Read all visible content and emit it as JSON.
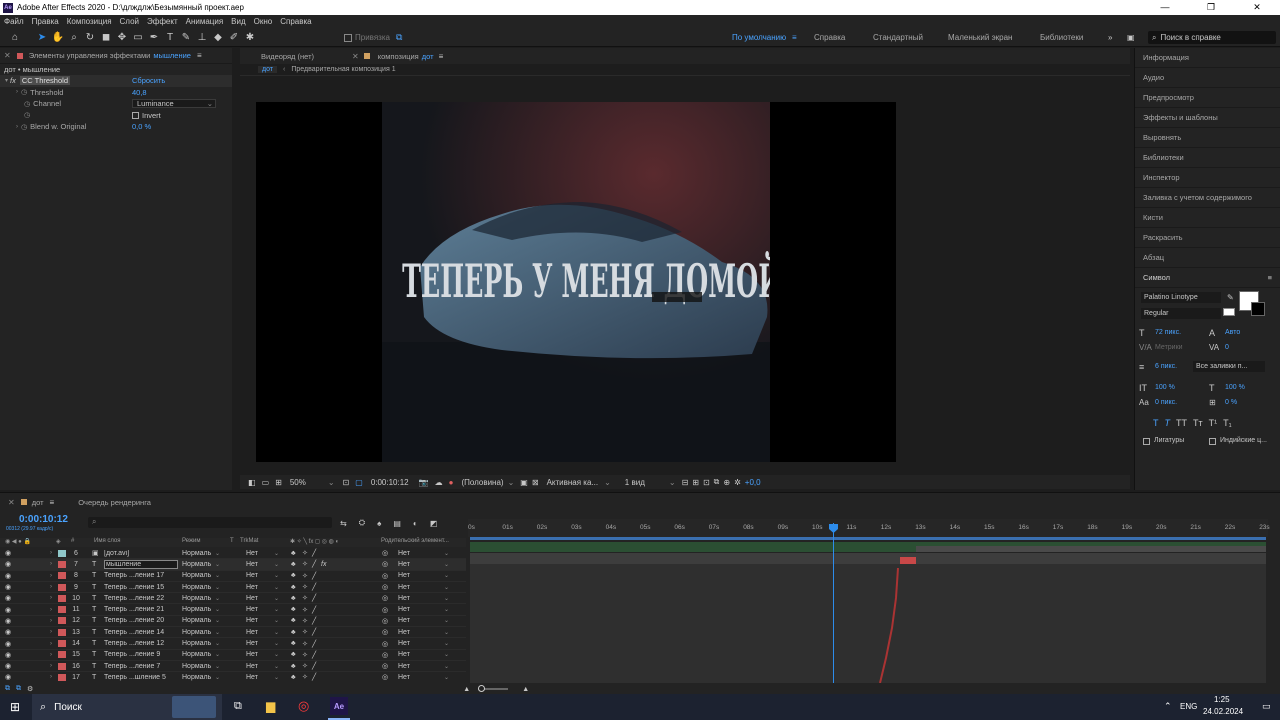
{
  "window": {
    "title": "Adobe After Effects 2020 - D:\\длждлж\\Безымянный проект.aep",
    "logo": "Ae"
  },
  "menu": [
    "Файл",
    "Правка",
    "Композиция",
    "Слой",
    "Эффект",
    "Анимация",
    "Вид",
    "Окно",
    "Справка"
  ],
  "toolbar": {
    "snap_label": "Привязка",
    "workspaces": [
      "По умолчанию",
      "Справка",
      "Стандартный",
      "Маленький экран",
      "Библиотеки"
    ],
    "help_search_placeholder": "Поиск в справке"
  },
  "effects_panel": {
    "tab_label": "Элементы управления эффектами",
    "tab_layer": "мышление",
    "breadcrumb": "дот • мышление",
    "effect_name": "CC Threshold",
    "reset_label": "Сбросить",
    "params": [
      {
        "label": "Threshold",
        "value": "40,8"
      },
      {
        "label": "Channel",
        "value": "Luminance"
      },
      {
        "label": "",
        "value": "Invert"
      },
      {
        "label": "Blend w. Original",
        "value": "0,0 %"
      }
    ]
  },
  "comp_panel": {
    "tab_footage": "Видеоряд (нет)",
    "tab_comp": "композиция",
    "tab_comp_name": "дот",
    "breadcrumb_active": "дот",
    "breadcrumb_next": "Предварительная композиция 1",
    "image_text": "ТЕПЕРЬ У МЕНЯ ДОМОЙ",
    "footer": {
      "zoom": "50%",
      "timecode": "0:00:10:12",
      "resolution": "(Половина)",
      "camera": "Активная ка...",
      "views": "1 вид",
      "exposure": "+0,0"
    }
  },
  "right_panel": {
    "items": [
      "Информация",
      "Аудио",
      "Предпросмотр",
      "Эффекты и шаблоны",
      "Выровнять",
      "Библиотеки",
      "Инспектор",
      "Заливка с учетом содержимого",
      "Кисти",
      "Раскрасить",
      "Абзац",
      "Символ"
    ],
    "character": {
      "font": "Palatino Linotype",
      "style": "Regular",
      "size": "72 пикс.",
      "leading": "Авто",
      "kerning": "Метрики",
      "tracking": "0",
      "stroke": "6 пикс.",
      "stroke_mode": "Все заливки п...",
      "vscale": "100 %",
      "hscale": "100 %",
      "baseline": "0 пикс.",
      "tsume": "0 %",
      "ligatures": "Лигатуры",
      "hindi": "Индийские ц..."
    }
  },
  "timeline": {
    "tab_comp": "дот",
    "tab_render": "Очередь рендеринга",
    "timecode": "0:00:10:12",
    "fps": "00312 (29.97 кадр/с)",
    "columns": {
      "name": "Имя слоя",
      "mode": "Режим",
      "t": "T",
      "trkmat": "TrkMat",
      "parent": "Родительский элемент..."
    },
    "ruler": [
      "0s",
      "01s",
      "02s",
      "03s",
      "04s",
      "05s",
      "06s",
      "07s",
      "08s",
      "09s",
      "10s",
      "11s",
      "12s",
      "13s",
      "14s",
      "15s",
      "16s",
      "17s",
      "18s",
      "19s",
      "20s",
      "21s",
      "22s",
      "23s"
    ],
    "layers": [
      {
        "num": "6",
        "name": "[дот.avi]",
        "mode": "Нормаль",
        "trk": "Нет",
        "parent": "Нет",
        "color": "#8fc7c9",
        "type": "▣"
      },
      {
        "num": "7",
        "name": "мышление",
        "mode": "Нормаль",
        "trk": "Нет",
        "parent": "Нет",
        "color": "#d0585a",
        "type": "T"
      },
      {
        "num": "8",
        "name": "Теперь ...ление 17",
        "mode": "Нормаль",
        "trk": "Нет",
        "parent": "Нет",
        "color": "#d0585a",
        "type": "T"
      },
      {
        "num": "9",
        "name": "Теперь ...ление 15",
        "mode": "Нормаль",
        "trk": "Нет",
        "parent": "Нет",
        "color": "#d0585a",
        "type": "T"
      },
      {
        "num": "10",
        "name": "Теперь ...ление 22",
        "mode": "Нормаль",
        "trk": "Нет",
        "parent": "Нет",
        "color": "#d0585a",
        "type": "T"
      },
      {
        "num": "11",
        "name": "Теперь ...ление 21",
        "mode": "Нормаль",
        "trk": "Нет",
        "parent": "Нет",
        "color": "#d0585a",
        "type": "T"
      },
      {
        "num": "12",
        "name": "Теперь ...ление 20",
        "mode": "Нормаль",
        "trk": "Нет",
        "parent": "Нет",
        "color": "#d0585a",
        "type": "T"
      },
      {
        "num": "13",
        "name": "Теперь ...ление 14",
        "mode": "Нормаль",
        "trk": "Нет",
        "parent": "Нет",
        "color": "#d0585a",
        "type": "T"
      },
      {
        "num": "14",
        "name": "Теперь ...ление 12",
        "mode": "Нормаль",
        "trk": "Нет",
        "parent": "Нет",
        "color": "#d0585a",
        "type": "T"
      },
      {
        "num": "15",
        "name": "Теперь ...ление 9",
        "mode": "Нормаль",
        "trk": "Нет",
        "parent": "Нет",
        "color": "#d0585a",
        "type": "T"
      },
      {
        "num": "16",
        "name": "Теперь ...ление 7",
        "mode": "Нормаль",
        "trk": "Нет",
        "parent": "Нет",
        "color": "#d0585a",
        "type": "T"
      },
      {
        "num": "17",
        "name": "Теперь ...шление 5",
        "mode": "Нормаль",
        "trk": "Нет",
        "parent": "Нет",
        "color": "#d0585a",
        "type": "T"
      }
    ]
  },
  "taskbar": {
    "search_placeholder": "Поиск",
    "lang": "ENG",
    "time": "1:25",
    "date": "24.02.2024"
  },
  "colors": {
    "accent": "#2d8ceb",
    "label_red": "#d0585a",
    "label_teal": "#8fc7c9"
  }
}
